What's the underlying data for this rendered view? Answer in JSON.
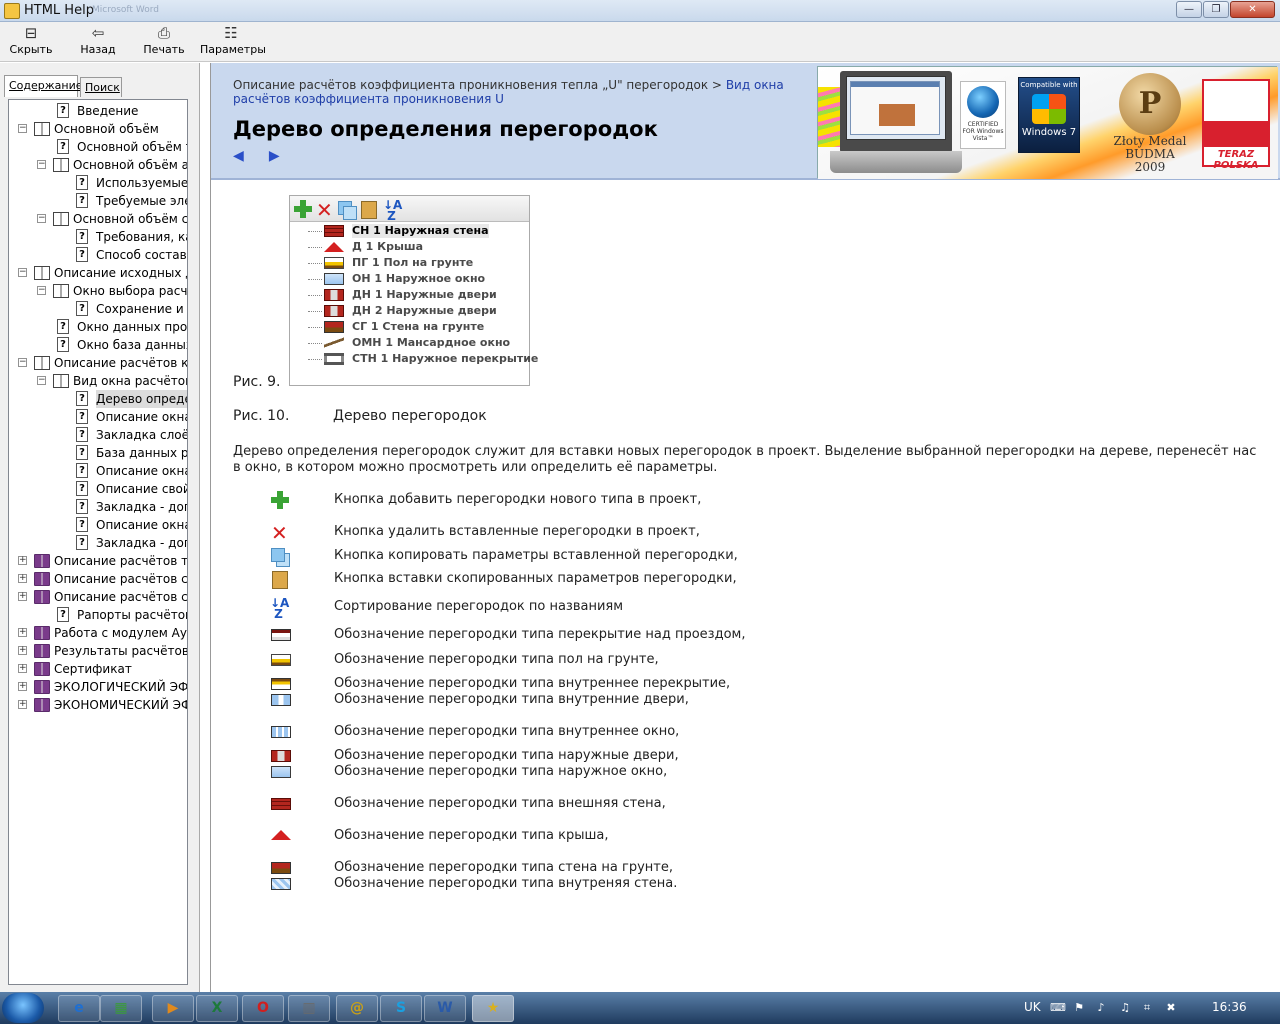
{
  "window": {
    "title": "HTML Help",
    "ghost_text": "Microsoft Word",
    "min_label": "—",
    "max_label": "❐",
    "close_label": "✕"
  },
  "toolbar": {
    "hide_label": "Скрыть",
    "back_label": "Назад",
    "print_label": "Печать",
    "options_label": "Параметры"
  },
  "left": {
    "tab_contents": "Содержание",
    "tab_search": "Поиск"
  },
  "tree": [
    {
      "label": "Введение"
    },
    {
      "label": "Основной объём"
    },
    {
      "label": "Основной объём те"
    },
    {
      "label": "Основной объём а"
    },
    {
      "label": "Используемые"
    },
    {
      "label": "Требуемые эле"
    },
    {
      "label": "Основной объём с"
    },
    {
      "label": "Требования, ка"
    },
    {
      "label": "Способ составл"
    },
    {
      "label": "Описание исходных да"
    },
    {
      "label": "Окно выбора расчё"
    },
    {
      "label": "Сохранение и с"
    },
    {
      "label": "Окно данных прое"
    },
    {
      "label": "Окно база данных"
    },
    {
      "label": "Описание расчётов ко"
    },
    {
      "label": "Вид окна расчётов"
    },
    {
      "label": "Дерево определ"
    },
    {
      "label": "Описание окна"
    },
    {
      "label": "Закладка слоёв"
    },
    {
      "label": "База данных ре"
    },
    {
      "label": "Описание окна"
    },
    {
      "label": "Описание свойс"
    },
    {
      "label": "Закладка - допо"
    },
    {
      "label": "Описание окна"
    },
    {
      "label": "Закладка - допо"
    },
    {
      "label": "Описание расчётов те"
    },
    {
      "label": "Описание расчётов се"
    },
    {
      "label": "Описание расчётов се"
    },
    {
      "label": "Рапорты расчётов"
    },
    {
      "label": "Работа с модулем Ауд"
    },
    {
      "label": "Результаты расчётов м"
    },
    {
      "label": "Сертификат"
    },
    {
      "label": "ЭКОЛОГИЧЕСКИЙ ЭФ"
    },
    {
      "label": "ЭКОНОМИЧЕСКИЙ ЭФ"
    }
  ],
  "scroll_label": "|||",
  "header": {
    "crumb_text": "Описание расчётов коэффициента проникновения тепла „U\" перегородок >",
    "crumb_link": "Вид окна расчётов коэффициента проникновения U",
    "title": "Дерево определения перегородок"
  },
  "banner": {
    "vista_text": "CERTIFIED FOR Windows Vista™",
    "win7_top": "Compatible with",
    "win7_name": "Windows 7",
    "medal_line1": "Złoty Medal",
    "medal_line2": "BUDMA 2009",
    "teraz": "TERAZ POLSKA"
  },
  "figure_items": [
    "СН 1 Наружная стена",
    "Д 1 Крыша",
    "ПГ 1 Пол на грунте",
    "ОН 1 Наружное окно",
    "ДН 1 Наружные двери",
    "ДН 2 Наружные двери",
    "СГ 1 Стена на грунте",
    "ОМН 1 Мансардное окно",
    "СТН 1 Наружное перекрытие"
  ],
  "captions": {
    "fig9": "Рис. 9.",
    "fig10_label": "Рис. 10.",
    "fig10_title": "Дерево перегородок"
  },
  "intro": "Дерево определения перегородок служит для вставки новых перегородок в проект. Выделение выбранной перегородки на дереве, перенесёт нас в окно, в котором можно просмотреть или определить её параметры.",
  "legend": [
    {
      "icon": "add-icon",
      "text": "Кнопка  добавить перегородки нового типа в проект,"
    },
    {
      "icon": "delete-icon",
      "text": "Кнопка  удалить вставленные перегородки в проект,"
    },
    {
      "icon": "copy-icon",
      "text": "Кнопка  копировать параметры вставленной перегородки,"
    },
    {
      "icon": "paste-icon",
      "text": "Кнопка  вставки скопированных параметров перегородки,"
    },
    {
      "icon": "sort-az-icon",
      "text": "Сортирование перегородок по названиям"
    },
    {
      "icon": "overpass-ceiling-icon",
      "text": "Обозначение перегородки типа перекрытие над проездом,"
    },
    {
      "icon": "floor-on-ground-icon",
      "text": "Обозначение перегородки типа пол на грунте,"
    },
    {
      "icon": "internal-ceiling-icon",
      "text": "Обозначение перегородки типа внутреннее перекрытие,"
    },
    {
      "icon": "internal-door-icon",
      "text": "Обозначение перегородки типа внутренние двери,"
    },
    {
      "icon": "internal-window-icon",
      "text": "Обозначение перегородки типа внутреннее окно,"
    },
    {
      "icon": "external-door-icon",
      "text": "Обозначение перегородки типа наружные двери,"
    },
    {
      "icon": "external-window-icon",
      "text": "Обозначение перегородки типа наружное окно,"
    },
    {
      "icon": "external-wall-icon",
      "text": "Обозначение перегородки типа внешняя стена,"
    },
    {
      "icon": "roof-icon",
      "text": "Обозначение перегородки типа крыша,"
    },
    {
      "icon": "wall-on-ground-icon",
      "text": "Обозначение перегородки типа стена на грунте,"
    },
    {
      "icon": "internal-wall-icon",
      "text": "Обозначение перегородки типа внутреняя стена."
    }
  ],
  "taskbar": {
    "lang": "UK",
    "time": "16:36",
    "items": [
      "e",
      "▦",
      "▶",
      "X",
      "O",
      "▥",
      "@",
      "S",
      "W",
      "★"
    ]
  }
}
